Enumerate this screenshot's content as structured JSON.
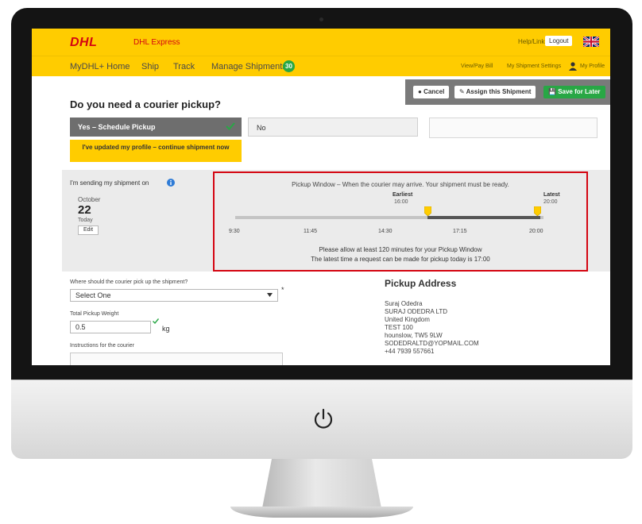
{
  "header": {
    "logo": "DHL",
    "logo_sub": "",
    "brand": "DHL Express",
    "help_link": "Help/Links",
    "login": "Logout"
  },
  "nav": {
    "items": [
      "MyDHL+ Home",
      "Ship",
      "Track",
      "Manage Shipments"
    ],
    "badge": "30",
    "right_link1": "View/Pay Bill",
    "right_link2": "My Shipment Settings",
    "user": "My Profile"
  },
  "actions": {
    "cancel": "Cancel",
    "assign": "Assign this Shipment",
    "save": "Save for Later"
  },
  "page": {
    "title": "Do you need a courier pickup?",
    "option_yes": "Yes – Schedule Pickup",
    "option_no": "No",
    "profile_btn": "I've updated my profile – continue shipment now"
  },
  "schedule": {
    "sending_label": "I'm sending my shipment on",
    "month": "October",
    "day": "22",
    "today": "Today",
    "edit": "Edit"
  },
  "pickup_window": {
    "title": "Pickup Window – When the courier may arrive. Your shipment must be ready.",
    "earliest_label": "Earliest",
    "earliest_time": "16:00",
    "latest_label": "Latest",
    "latest_time": "20:00",
    "ticks": [
      "9:30",
      "11:45",
      "14:30",
      "17:15",
      "20:00"
    ],
    "note1": "Please allow at least 120 minutes for your Pickup Window",
    "note2": "The latest time a request can be made for pickup today is 17:00"
  },
  "form": {
    "location_label": "Where should the courier pick up the shipment?",
    "location_value": "Select One",
    "required": "*",
    "weight_label": "Total Pickup Weight",
    "weight_value": "0.5",
    "weight_unit": "kg",
    "instructions_label": "Instructions for the courier"
  },
  "address": {
    "title": "Pickup Address",
    "lines": [
      "Suraj Odedra",
      "SURAJ ODEDRA LTD",
      "United Kingdom",
      "TEST 100",
      "hounslow, TW5 9LW",
      "SODEDRALTD@YOPMAIL.COM",
      "+44 7939 557661"
    ]
  },
  "colors": {
    "brand_yellow": "#ffcc00",
    "brand_red": "#d40511",
    "success_green": "#28a745"
  }
}
